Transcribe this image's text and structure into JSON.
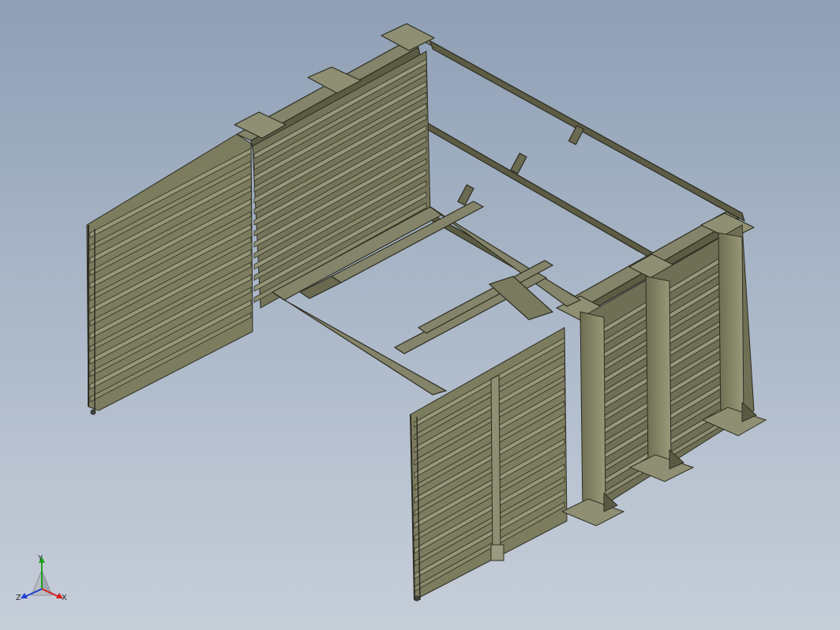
{
  "viewport": {
    "background_top": "#8f9fb5",
    "background_bottom": "#c6ced9",
    "model_color": "#7a7a5c",
    "edge_color": "#2d2d22"
  },
  "triad": {
    "labels": {
      "x": "X",
      "y": "Y",
      "z": "Z"
    },
    "colors": {
      "x": "#d82020",
      "y": "#20a020",
      "z": "#2040d0"
    }
  }
}
